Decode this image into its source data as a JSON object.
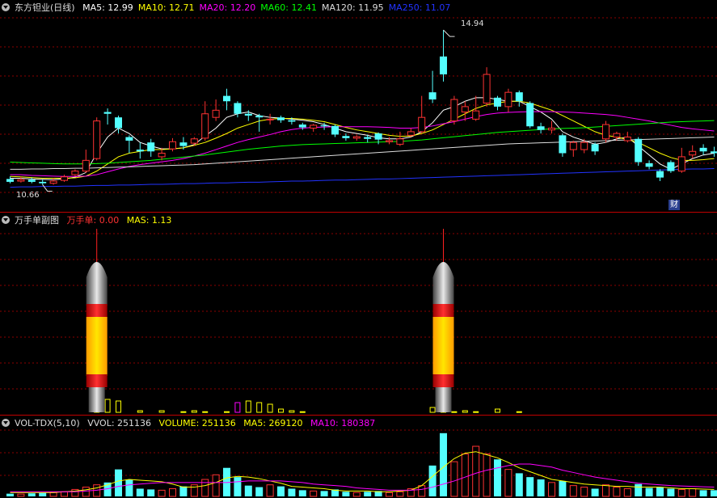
{
  "stock": {
    "title": "东方钽业(日线)"
  },
  "ma_legend": [
    {
      "label": "MA5: 12.99",
      "color": "#ffffff"
    },
    {
      "label": "MA10: 12.71",
      "color": "#ffff00"
    },
    {
      "label": "MA20: 12.20",
      "color": "#ff00ff"
    },
    {
      "label": "MA60: 12.41",
      "color": "#00ff00"
    },
    {
      "label": "MA120: 11.95",
      "color": "#dddddd"
    },
    {
      "label": "MA250: 11.07",
      "color": "#2233ff"
    }
  ],
  "price": {
    "high_label": "14.94",
    "low_label": "10.66",
    "event_badge": "财"
  },
  "sub1": {
    "title": "万手单副图",
    "indicator": "万手单: 0.00",
    "mas": "MAS: 1.13"
  },
  "sub3": {
    "title": "VOL-TDX(5,10)",
    "vvol": "VVOL: 251136",
    "volume": "VOLUME: 251136",
    "ma5": "MA5: 269120",
    "ma10": "MA10: 180387"
  },
  "colors": {
    "up": "#ff3232",
    "down": "#54ffff",
    "bg": "#000000",
    "grid": "#8b0000"
  },
  "chart_data": {
    "type": "candlestick",
    "candles": [
      {
        "o": 10.78,
        "c": 10.7,
        "h": 10.85,
        "l": 10.66
      },
      {
        "o": 10.72,
        "c": 10.76,
        "h": 10.84,
        "l": 10.68
      },
      {
        "o": 10.76,
        "c": 10.7,
        "h": 10.82,
        "l": 10.66
      },
      {
        "o": 10.7,
        "c": 10.66,
        "h": 10.76,
        "l": 10.62
      },
      {
        "o": 10.66,
        "c": 10.72,
        "h": 10.8,
        "l": 10.62
      },
      {
        "o": 10.74,
        "c": 10.84,
        "h": 10.9,
        "l": 10.7
      },
      {
        "o": 10.9,
        "c": 11.0,
        "h": 11.05,
        "l": 10.86
      },
      {
        "o": 11.0,
        "c": 11.3,
        "h": 11.6,
        "l": 10.95
      },
      {
        "o": 11.35,
        "c": 12.4,
        "h": 12.5,
        "l": 11.3
      },
      {
        "o": 12.65,
        "c": 12.6,
        "h": 12.75,
        "l": 12.3
      },
      {
        "o": 12.5,
        "c": 12.2,
        "h": 12.55,
        "l": 12.05
      },
      {
        "o": 11.95,
        "c": 11.85,
        "h": 12.0,
        "l": 11.5
      },
      {
        "o": 11.6,
        "c": 11.55,
        "h": 11.8,
        "l": 11.35
      },
      {
        "o": 11.8,
        "c": 11.55,
        "h": 11.9,
        "l": 11.4
      },
      {
        "o": 11.4,
        "c": 11.5,
        "h": 11.65,
        "l": 11.3
      },
      {
        "o": 11.62,
        "c": 11.82,
        "h": 11.92,
        "l": 11.55
      },
      {
        "o": 11.8,
        "c": 11.7,
        "h": 11.95,
        "l": 11.6
      },
      {
        "o": 11.78,
        "c": 11.9,
        "h": 11.95,
        "l": 11.7
      },
      {
        "o": 11.92,
        "c": 12.6,
        "h": 12.95,
        "l": 11.85
      },
      {
        "o": 12.5,
        "c": 12.7,
        "h": 13.0,
        "l": 12.4
      },
      {
        "o": 13.1,
        "c": 12.95,
        "h": 13.3,
        "l": 12.7
      },
      {
        "o": 12.9,
        "c": 12.6,
        "h": 12.95,
        "l": 12.5
      },
      {
        "o": 12.6,
        "c": 12.55,
        "h": 12.7,
        "l": 12.4
      },
      {
        "o": 12.55,
        "c": 12.5,
        "h": 12.6,
        "l": 12.1
      },
      {
        "o": 12.45,
        "c": 12.45,
        "h": 12.6,
        "l": 12.3
      },
      {
        "o": 12.5,
        "c": 12.42,
        "h": 12.55,
        "l": 12.35
      },
      {
        "o": 12.42,
        "c": 12.38,
        "h": 12.5,
        "l": 12.3
      },
      {
        "o": 12.3,
        "c": 12.22,
        "h": 12.35,
        "l": 12.15
      },
      {
        "o": 12.2,
        "c": 12.28,
        "h": 12.32,
        "l": 12.1
      },
      {
        "o": 12.28,
        "c": 12.25,
        "h": 12.35,
        "l": 12.15
      },
      {
        "o": 12.26,
        "c": 12.02,
        "h": 12.3,
        "l": 11.95
      },
      {
        "o": 11.98,
        "c": 11.92,
        "h": 12.05,
        "l": 11.85
      },
      {
        "o": 11.92,
        "c": 11.96,
        "h": 12.0,
        "l": 11.85
      },
      {
        "o": 11.95,
        "c": 11.9,
        "h": 12.02,
        "l": 11.8
      },
      {
        "o": 12.05,
        "c": 11.88,
        "h": 12.08,
        "l": 11.75
      },
      {
        "o": 11.82,
        "c": 11.85,
        "h": 11.95,
        "l": 11.75
      },
      {
        "o": 11.75,
        "c": 11.9,
        "h": 12.1,
        "l": 11.7
      },
      {
        "o": 12.0,
        "c": 12.1,
        "h": 12.2,
        "l": 11.95
      },
      {
        "o": 12.1,
        "c": 12.5,
        "h": 13.1,
        "l": 12.05
      },
      {
        "o": 13.2,
        "c": 13.0,
        "h": 13.8,
        "l": 12.9
      },
      {
        "o": 14.2,
        "c": 13.7,
        "h": 14.94,
        "l": 13.5
      },
      {
        "o": 12.4,
        "c": 13.0,
        "h": 13.1,
        "l": 12.3
      },
      {
        "o": 12.65,
        "c": 12.8,
        "h": 12.95,
        "l": 12.4
      },
      {
        "o": 12.45,
        "c": 12.68,
        "h": 13.1,
        "l": 12.4
      },
      {
        "o": 12.9,
        "c": 13.7,
        "h": 13.9,
        "l": 12.8
      },
      {
        "o": 13.05,
        "c": 12.8,
        "h": 13.1,
        "l": 12.7
      },
      {
        "o": 12.8,
        "c": 13.2,
        "h": 13.3,
        "l": 12.65
      },
      {
        "o": 13.2,
        "c": 12.95,
        "h": 13.25,
        "l": 12.8
      },
      {
        "o": 12.9,
        "c": 12.25,
        "h": 12.95,
        "l": 12.2
      },
      {
        "o": 12.25,
        "c": 12.15,
        "h": 12.35,
        "l": 12.05
      },
      {
        "o": 12.15,
        "c": 12.2,
        "h": 12.4,
        "l": 12.05
      },
      {
        "o": 12.0,
        "c": 11.5,
        "h": 12.05,
        "l": 11.4
      },
      {
        "o": 11.6,
        "c": 11.8,
        "h": 11.85,
        "l": 11.4
      },
      {
        "o": 11.6,
        "c": 11.8,
        "h": 11.9,
        "l": 11.5
      },
      {
        "o": 11.75,
        "c": 11.55,
        "h": 11.8,
        "l": 11.45
      },
      {
        "o": 11.9,
        "c": 12.3,
        "h": 12.4,
        "l": 11.8
      },
      {
        "o": 11.95,
        "c": 12.05,
        "h": 12.1,
        "l": 11.85
      },
      {
        "o": 11.85,
        "c": 11.95,
        "h": 12.1,
        "l": 11.8
      },
      {
        "o": 11.9,
        "c": 11.25,
        "h": 11.95,
        "l": 11.15
      },
      {
        "o": 11.22,
        "c": 11.12,
        "h": 11.3,
        "l": 11.05
      },
      {
        "o": 11.0,
        "c": 10.82,
        "h": 11.05,
        "l": 10.72
      },
      {
        "o": 11.25,
        "c": 11.0,
        "h": 11.3,
        "l": 10.95
      },
      {
        "o": 11.0,
        "c": 11.4,
        "h": 11.65,
        "l": 10.95
      },
      {
        "o": 11.45,
        "c": 11.55,
        "h": 11.72,
        "l": 11.35
      },
      {
        "o": 11.65,
        "c": 11.55,
        "h": 11.75,
        "l": 11.45
      },
      {
        "o": 11.55,
        "c": 11.5,
        "h": 11.68,
        "l": 11.4
      }
    ],
    "ma": {
      "MA5": [
        10.8,
        10.8,
        10.78,
        10.77,
        10.76,
        10.78,
        10.83,
        10.96,
        11.5,
        11.95,
        12.2,
        12.05,
        11.8,
        11.7,
        11.62,
        11.62,
        11.65,
        11.74,
        11.98,
        12.2,
        12.5,
        12.6,
        12.65,
        12.55,
        12.5,
        12.48,
        12.45,
        12.42,
        12.38,
        12.3,
        12.2,
        12.1,
        12.05,
        12.0,
        11.93,
        11.9,
        11.9,
        11.95,
        12.1,
        12.35,
        12.7,
        12.8,
        12.95,
        13.05,
        13.05,
        13.0,
        12.95,
        12.95,
        12.8,
        12.65,
        12.45,
        12.1,
        11.95,
        11.85,
        11.75,
        11.8,
        11.9,
        11.95,
        11.7,
        11.45,
        11.2,
        11.05,
        11.2,
        11.35,
        11.45,
        11.5
      ],
      "MA10": [
        10.85,
        10.84,
        10.82,
        10.8,
        10.8,
        10.8,
        10.81,
        10.86,
        11.0,
        11.2,
        11.4,
        11.5,
        11.55,
        11.6,
        11.6,
        11.62,
        11.65,
        11.72,
        11.8,
        11.92,
        12.05,
        12.2,
        12.3,
        12.4,
        12.45,
        12.47,
        12.47,
        12.45,
        12.42,
        12.38,
        12.3,
        12.22,
        12.15,
        12.1,
        12.05,
        12.0,
        11.97,
        11.98,
        12.05,
        12.15,
        12.3,
        12.45,
        12.6,
        12.75,
        12.85,
        12.9,
        12.95,
        12.95,
        12.9,
        12.8,
        12.7,
        12.55,
        12.4,
        12.25,
        12.1,
        12.0,
        11.95,
        11.88,
        11.8,
        11.65,
        11.5,
        11.38,
        11.3,
        11.3,
        11.32,
        11.35
      ],
      "MA20": [
        10.9,
        10.9,
        10.88,
        10.87,
        10.86,
        10.85,
        10.85,
        10.86,
        10.9,
        10.98,
        11.06,
        11.13,
        11.18,
        11.22,
        11.26,
        11.3,
        11.35,
        11.42,
        11.5,
        11.6,
        11.7,
        11.8,
        11.88,
        11.95,
        12.02,
        12.1,
        12.16,
        12.2,
        12.22,
        12.23,
        12.24,
        12.24,
        12.24,
        12.24,
        12.23,
        12.22,
        12.2,
        12.2,
        12.22,
        12.26,
        12.32,
        12.38,
        12.45,
        12.52,
        12.58,
        12.62,
        12.64,
        12.65,
        12.66,
        12.66,
        12.66,
        12.65,
        12.64,
        12.62,
        12.6,
        12.58,
        12.55,
        12.5,
        12.45,
        12.4,
        12.34,
        12.28,
        12.22,
        12.18,
        12.15,
        12.12
      ],
      "MA60": [
        11.25,
        11.24,
        11.23,
        11.22,
        11.21,
        11.2,
        11.2,
        11.2,
        11.21,
        11.22,
        11.24,
        11.26,
        11.28,
        11.3,
        11.33,
        11.36,
        11.39,
        11.42,
        11.45,
        11.49,
        11.53,
        11.57,
        11.61,
        11.64,
        11.67,
        11.7,
        11.72,
        11.74,
        11.75,
        11.76,
        11.77,
        11.78,
        11.79,
        11.8,
        11.81,
        11.82,
        11.83,
        11.85,
        11.87,
        11.9,
        11.93,
        11.96,
        11.99,
        12.02,
        12.05,
        12.08,
        12.1,
        12.12,
        12.14,
        12.16,
        12.18,
        12.19,
        12.2,
        12.21,
        12.23,
        12.25,
        12.27,
        12.29,
        12.31,
        12.33,
        12.35,
        12.37,
        12.38,
        12.39,
        12.4,
        12.41
      ],
      "MA120": [
        11.05,
        11.05,
        11.06,
        11.06,
        11.07,
        11.07,
        11.08,
        11.08,
        11.09,
        11.1,
        11.11,
        11.12,
        11.13,
        11.14,
        11.15,
        11.16,
        11.17,
        11.18,
        11.2,
        11.22,
        11.24,
        11.26,
        11.28,
        11.3,
        11.32,
        11.34,
        11.36,
        11.38,
        11.4,
        11.42,
        11.44,
        11.46,
        11.48,
        11.5,
        11.52,
        11.54,
        11.56,
        11.58,
        11.6,
        11.62,
        11.64,
        11.66,
        11.68,
        11.7,
        11.72,
        11.74,
        11.76,
        11.77,
        11.78,
        11.79,
        11.8,
        11.81,
        11.82,
        11.83,
        11.84,
        11.85,
        11.86,
        11.87,
        11.88,
        11.89,
        11.9,
        11.91,
        11.92,
        11.93,
        11.94,
        11.95
      ],
      "MA250": [
        10.55,
        10.56,
        10.56,
        10.57,
        10.57,
        10.58,
        10.58,
        10.59,
        10.6,
        10.6,
        10.61,
        10.61,
        10.62,
        10.63,
        10.63,
        10.64,
        10.65,
        10.65,
        10.66,
        10.67,
        10.67,
        10.68,
        10.69,
        10.69,
        10.7,
        10.71,
        10.72,
        10.72,
        10.73,
        10.74,
        10.75,
        10.75,
        10.76,
        10.77,
        10.78,
        10.78,
        10.79,
        10.8,
        10.81,
        10.82,
        10.83,
        10.84,
        10.85,
        10.86,
        10.87,
        10.88,
        10.89,
        10.9,
        10.91,
        10.92,
        10.93,
        10.94,
        10.95,
        10.96,
        10.97,
        10.98,
        10.99,
        11.0,
        11.01,
        11.02,
        11.03,
        11.04,
        11.05,
        11.06,
        11.06,
        11.07
      ]
    },
    "ylim": [
      10.45,
      15.1
    ],
    "wanshou": [
      0,
      0,
      0,
      0,
      0,
      0,
      0,
      0,
      0.3,
      0.4,
      0.35,
      0,
      0.05,
      0,
      0.05,
      0,
      0.02,
      0.05,
      0.02,
      0,
      0.02,
      0.3,
      0.35,
      0.3,
      0.25,
      0.1,
      0.05,
      0.02,
      0,
      0,
      0,
      0,
      0,
      0,
      0,
      0,
      0,
      0,
      0,
      0.15,
      0.05,
      0.02,
      0.05,
      0.02,
      0,
      0.1,
      0,
      0.02,
      0,
      0,
      0,
      0,
      0,
      0,
      0,
      0,
      0,
      0,
      0,
      0,
      0,
      0,
      0,
      0,
      0,
      0
    ],
    "wanshou_spikes": [
      8,
      40
    ],
    "volume_series": [
      0.35,
      0.3,
      0.4,
      0.45,
      0.5,
      0.6,
      0.9,
      1.2,
      1.5,
      1.8,
      3.5,
      2.2,
      1.0,
      0.9,
      0.8,
      1.0,
      1.3,
      1.5,
      2.2,
      2.8,
      3.7,
      2.5,
      1.4,
      1.2,
      1.5,
      1.3,
      1.0,
      0.8,
      0.7,
      0.7,
      0.9,
      0.6,
      0.5,
      0.6,
      0.7,
      0.5,
      0.6,
      1.0,
      1.4,
      4.0,
      8.2,
      4.5,
      5.5,
      6.5,
      5.5,
      4.8,
      3.5,
      3.0,
      2.5,
      2.2,
      1.8,
      2.0,
      1.4,
      1.2,
      1.0,
      1.5,
      1.2,
      1.0,
      1.6,
      1.1,
      1.2,
      1.0,
      0.9,
      1.0,
      0.8,
      0.8
    ],
    "vol_ma5": [
      0.5,
      0.5,
      0.5,
      0.5,
      0.5,
      0.6,
      0.7,
      0.85,
      1.1,
      1.5,
      2.0,
      2.2,
      2.1,
      2.0,
      1.9,
      1.6,
      1.2,
      1.2,
      1.4,
      1.8,
      2.4,
      2.6,
      2.5,
      2.3,
      2.0,
      1.7,
      1.3,
      1.2,
      1.1,
      1.0,
      0.8,
      0.7,
      0.7,
      0.7,
      0.6,
      0.6,
      0.7,
      0.8,
      1.4,
      2.6,
      3.8,
      4.9,
      5.6,
      5.8,
      5.4,
      5.0,
      4.4,
      3.7,
      3.2,
      2.7,
      2.2,
      2.0,
      1.8,
      1.6,
      1.5,
      1.4,
      1.3,
      1.3,
      1.2,
      1.2,
      1.2,
      1.1,
      1.0,
      1.0,
      0.95,
      0.9
    ],
    "vol_ma10": [
      0.6,
      0.6,
      0.6,
      0.6,
      0.6,
      0.6,
      0.6,
      0.7,
      0.8,
      1.0,
      1.3,
      1.5,
      1.6,
      1.7,
      1.8,
      1.8,
      1.8,
      1.8,
      1.8,
      1.8,
      1.8,
      1.9,
      2.0,
      2.0,
      2.0,
      2.0,
      1.9,
      1.8,
      1.6,
      1.5,
      1.4,
      1.3,
      1.1,
      1.0,
      0.9,
      0.8,
      0.8,
      0.8,
      0.9,
      1.2,
      1.6,
      2.0,
      2.5,
      3.0,
      3.4,
      3.7,
      4.0,
      4.2,
      4.2,
      4.0,
      3.8,
      3.4,
      3.1,
      2.8,
      2.5,
      2.3,
      2.1,
      1.9,
      1.7,
      1.6,
      1.5,
      1.4,
      1.35,
      1.3,
      1.25,
      1.2
    ]
  }
}
